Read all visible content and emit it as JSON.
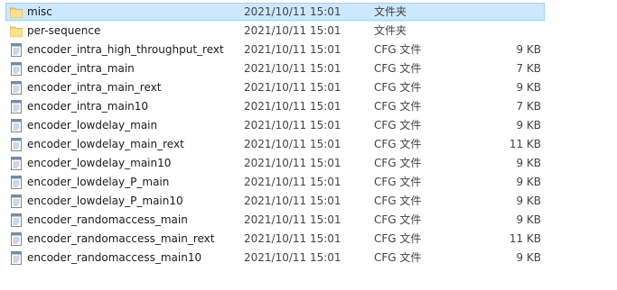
{
  "files": [
    {
      "name": "misc",
      "date": "2021/10/11 15:01",
      "type": "文件夹",
      "size": "",
      "icon": "folder-icon",
      "selected": true
    },
    {
      "name": "per-sequence",
      "date": "2021/10/11 15:01",
      "type": "文件夹",
      "size": "",
      "icon": "folder-icon",
      "selected": false
    },
    {
      "name": "encoder_intra_high_throughput_rext",
      "date": "2021/10/11 15:01",
      "type": "CFG 文件",
      "size": "9 KB",
      "icon": "cfg-file-icon",
      "selected": false
    },
    {
      "name": "encoder_intra_main",
      "date": "2021/10/11 15:01",
      "type": "CFG 文件",
      "size": "7 KB",
      "icon": "cfg-file-icon",
      "selected": false
    },
    {
      "name": "encoder_intra_main_rext",
      "date": "2021/10/11 15:01",
      "type": "CFG 文件",
      "size": "9 KB",
      "icon": "cfg-file-icon",
      "selected": false
    },
    {
      "name": "encoder_intra_main10",
      "date": "2021/10/11 15:01",
      "type": "CFG 文件",
      "size": "7 KB",
      "icon": "cfg-file-icon",
      "selected": false
    },
    {
      "name": "encoder_lowdelay_main",
      "date": "2021/10/11 15:01",
      "type": "CFG 文件",
      "size": "9 KB",
      "icon": "cfg-file-icon",
      "selected": false
    },
    {
      "name": "encoder_lowdelay_main_rext",
      "date": "2021/10/11 15:01",
      "type": "CFG 文件",
      "size": "11 KB",
      "icon": "cfg-file-icon",
      "selected": false
    },
    {
      "name": "encoder_lowdelay_main10",
      "date": "2021/10/11 15:01",
      "type": "CFG 文件",
      "size": "9 KB",
      "icon": "cfg-file-icon",
      "selected": false
    },
    {
      "name": "encoder_lowdelay_P_main",
      "date": "2021/10/11 15:01",
      "type": "CFG 文件",
      "size": "9 KB",
      "icon": "cfg-file-icon",
      "selected": false
    },
    {
      "name": "encoder_lowdelay_P_main10",
      "date": "2021/10/11 15:01",
      "type": "CFG 文件",
      "size": "9 KB",
      "icon": "cfg-file-icon",
      "selected": false
    },
    {
      "name": "encoder_randomaccess_main",
      "date": "2021/10/11 15:01",
      "type": "CFG 文件",
      "size": "9 KB",
      "icon": "cfg-file-icon",
      "selected": false
    },
    {
      "name": "encoder_randomaccess_main_rext",
      "date": "2021/10/11 15:01",
      "type": "CFG 文件",
      "size": "11 KB",
      "icon": "cfg-file-icon",
      "selected": false
    },
    {
      "name": "encoder_randomaccess_main10",
      "date": "2021/10/11 15:01",
      "type": "CFG 文件",
      "size": "9 KB",
      "icon": "cfg-file-icon",
      "selected": false
    }
  ],
  "colors": {
    "selection_bg": "#cce8ff",
    "selection_border": "#99d1ff",
    "folder": "#f8d775"
  }
}
